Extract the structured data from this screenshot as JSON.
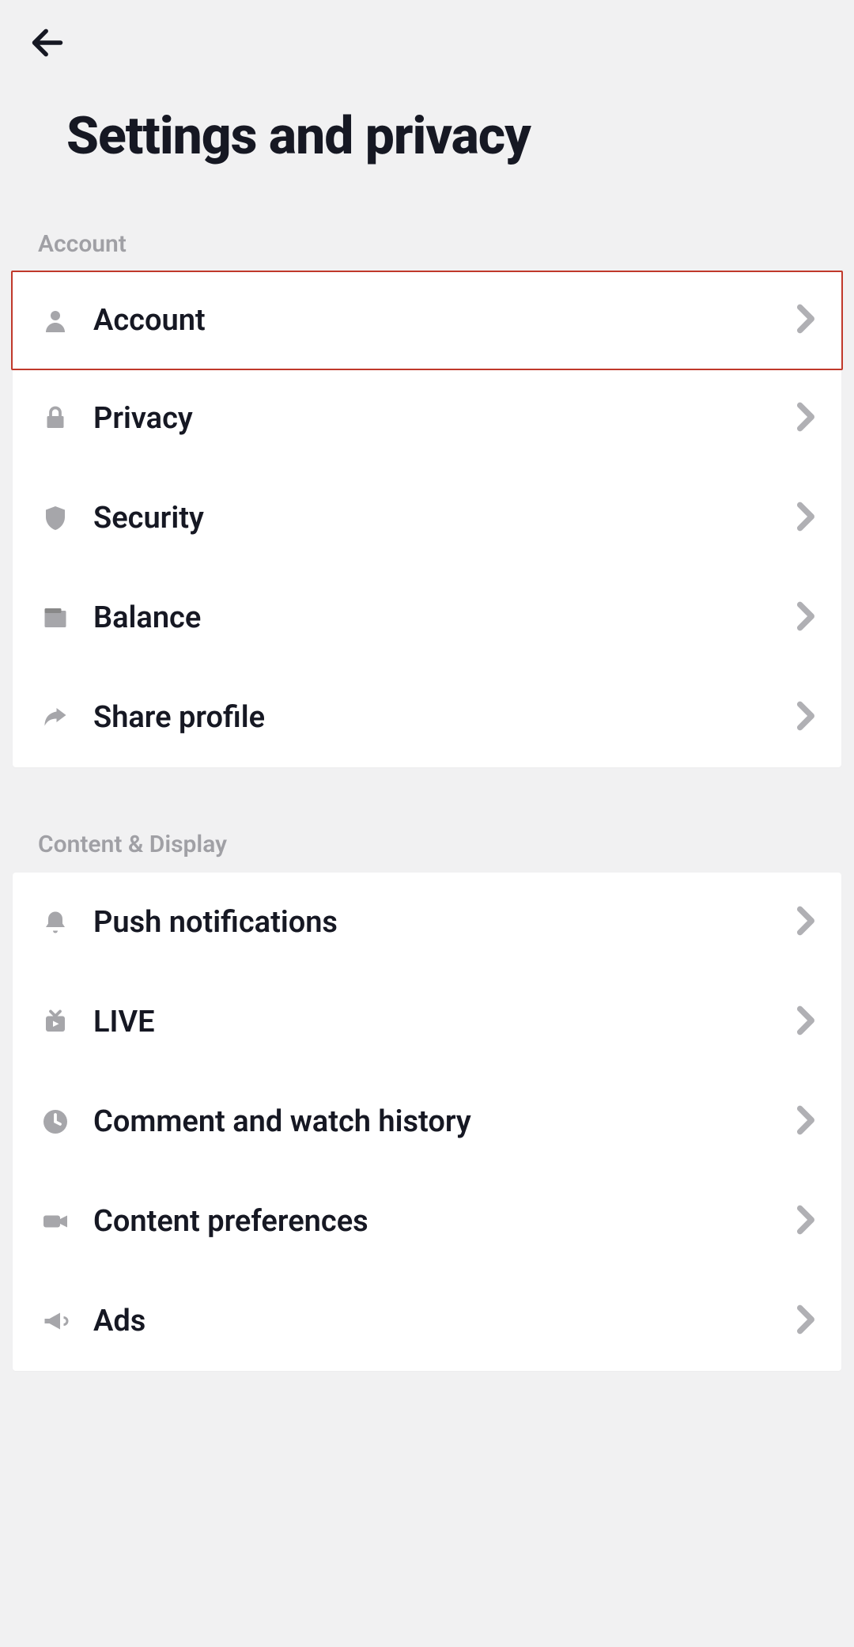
{
  "header": {
    "title": "Settings and privacy"
  },
  "sections": [
    {
      "label": "Account",
      "items": [
        {
          "icon": "person-icon",
          "label": "Account",
          "highlight": true
        },
        {
          "icon": "lock-icon",
          "label": "Privacy"
        },
        {
          "icon": "shield-icon",
          "label": "Security"
        },
        {
          "icon": "wallet-icon",
          "label": "Balance"
        },
        {
          "icon": "share-icon",
          "label": "Share profile"
        }
      ]
    },
    {
      "label": "Content & Display",
      "items": [
        {
          "icon": "bell-icon",
          "label": "Push notifications"
        },
        {
          "icon": "live-icon",
          "label": "LIVE"
        },
        {
          "icon": "clock-icon",
          "label": "Comment and watch history"
        },
        {
          "icon": "video-icon",
          "label": "Content preferences"
        },
        {
          "icon": "megaphone-icon",
          "label": "Ads"
        }
      ]
    }
  ]
}
